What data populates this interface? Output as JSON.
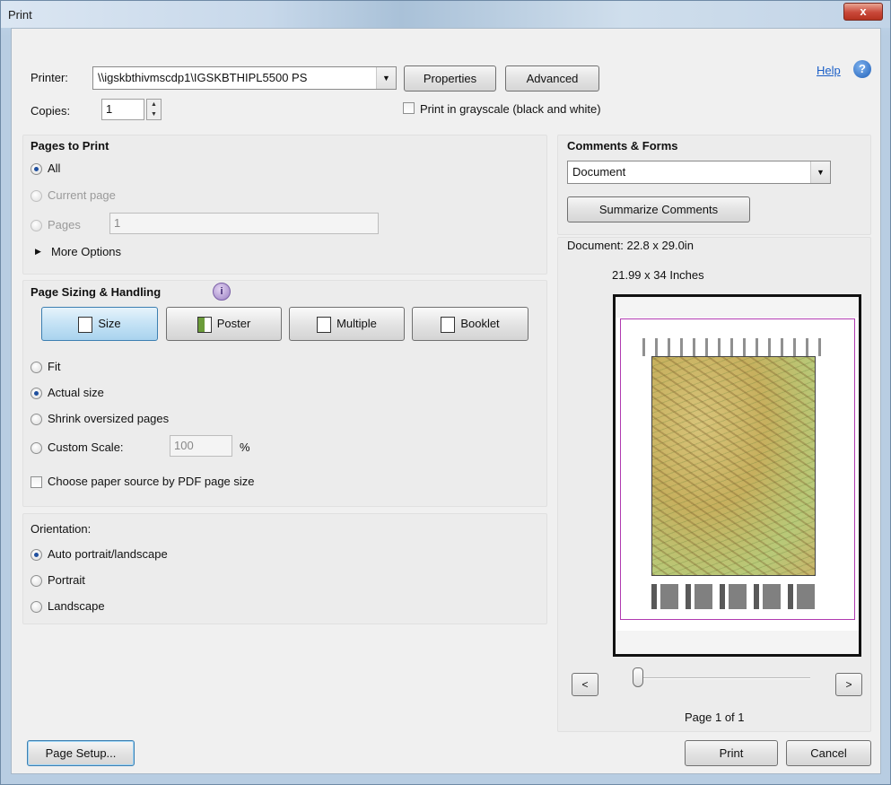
{
  "window": {
    "title": "Print",
    "close_label": "x"
  },
  "printer": {
    "label": "Printer:",
    "selected": "\\\\igskbthivmscdp1\\IGSKBTHIPL5500 PS",
    "properties_label": "Properties",
    "advanced_label": "Advanced",
    "help_label": "Help",
    "copies_label": "Copies:",
    "copies_value": "1",
    "grayscale_label": "Print in grayscale (black and white)",
    "grayscale_checked": false
  },
  "pages_to_print": {
    "title": "Pages to Print",
    "options": [
      {
        "label": "All",
        "selected": true,
        "enabled": true
      },
      {
        "label": "Current page",
        "selected": false,
        "enabled": false
      },
      {
        "label": "Pages",
        "selected": false,
        "enabled": false
      }
    ],
    "pages_value": "1",
    "more_options_label": "More Options"
  },
  "page_sizing": {
    "title": "Page Sizing & Handling",
    "modes": [
      "Size",
      "Poster",
      "Multiple",
      "Booklet"
    ],
    "selected_mode": "Size",
    "options": [
      {
        "label": "Fit",
        "selected": false
      },
      {
        "label": "Actual size",
        "selected": true
      },
      {
        "label": "Shrink oversized pages",
        "selected": false
      },
      {
        "label": "Custom Scale:",
        "selected": false
      }
    ],
    "custom_scale_value": "100",
    "custom_scale_unit": "%",
    "paper_source_label": "Choose paper source by PDF page size",
    "paper_source_checked": false
  },
  "orientation": {
    "title": "Orientation:",
    "options": [
      {
        "label": "Auto portrait/landscape",
        "selected": true
      },
      {
        "label": "Portrait",
        "selected": false
      },
      {
        "label": "Landscape",
        "selected": false
      }
    ]
  },
  "comments_forms": {
    "title": "Comments & Forms",
    "selected": "Document",
    "summarize_label": "Summarize Comments"
  },
  "preview": {
    "document_size": "Document: 22.8 x 29.0in",
    "paper_size": "21.99 x 34 Inches",
    "page_indicator": "Page 1 of 1",
    "prev_label": "<",
    "next_label": ">",
    "slider_position": 0.0
  },
  "footer": {
    "page_setup_label": "Page Setup...",
    "print_label": "Print",
    "cancel_label": "Cancel"
  },
  "colors": {
    "selected_mode_bg": "#c4e2f5",
    "map_base": "#c8b36a",
    "map_green": "#b8c978",
    "preview_border": "#b03ab0"
  }
}
